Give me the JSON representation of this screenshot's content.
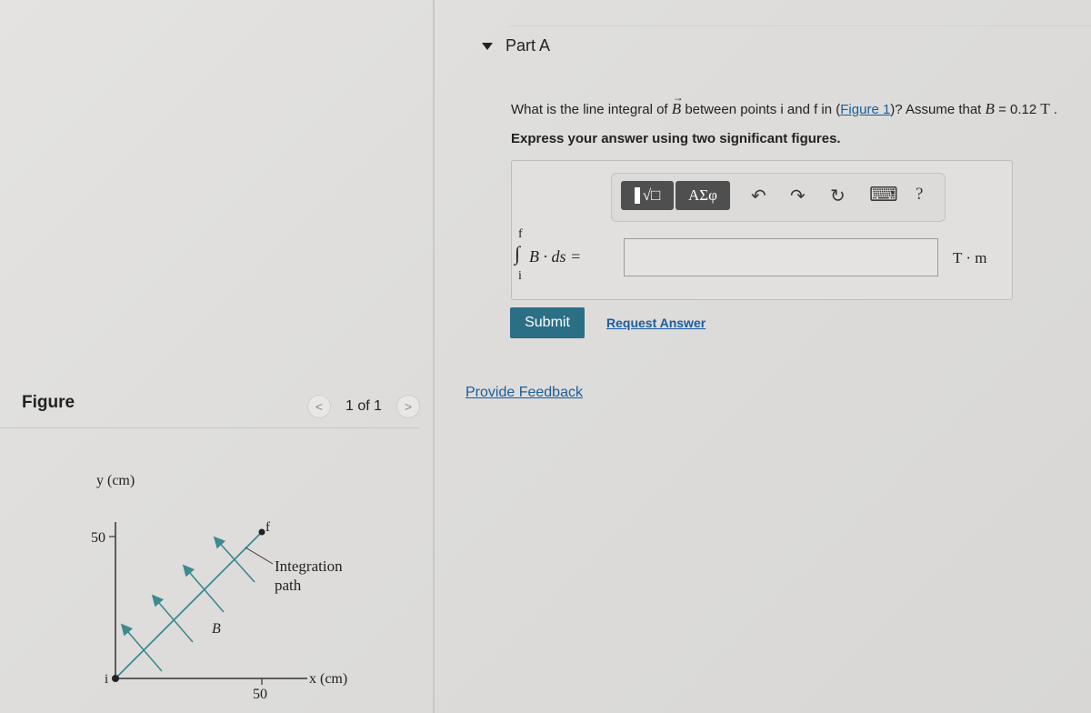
{
  "part": {
    "title": "Part A",
    "question_prefix": "What is the line integral of ",
    "question_vector": "B",
    "question_middle": " between points i and f in (",
    "figure_link": "Figure 1",
    "question_suffix": ")? Assume that ",
    "assumption_var": "B",
    "assumption_value": " = 0.12 ",
    "assumption_unit": "T",
    "assumption_end": " .",
    "instruction": "Express your answer using two significant figures."
  },
  "toolbar": {
    "templates_label": "√□",
    "greek_label": "ΑΣφ",
    "undo": "↶",
    "redo": "↷",
    "reset": "↻",
    "keyboard": "⌨",
    "help": "?"
  },
  "answer": {
    "upper_limit": "f",
    "lower_limit": "i",
    "integrand": "B · ds =",
    "value": "",
    "units": "T · m"
  },
  "actions": {
    "submit": "Submit",
    "request_answer": "Request Answer",
    "provide_feedback": "Provide Feedback"
  },
  "figure": {
    "title": "Figure",
    "pager_prev": "<",
    "pager_text": "1 of 1",
    "pager_next": ">",
    "y_axis_label": "y (cm)",
    "x_axis_label": "x (cm)",
    "y_tick": "50",
    "x_tick": "50",
    "point_start": "i",
    "point_end": "f",
    "field_label": "B",
    "path_label_1": "Integration",
    "path_label_2": "path"
  }
}
